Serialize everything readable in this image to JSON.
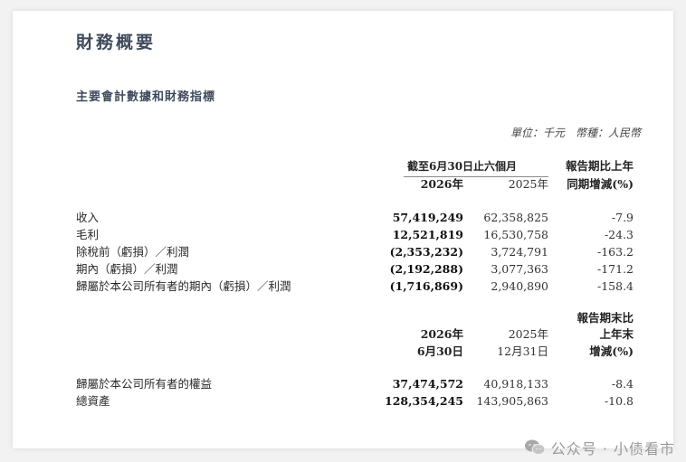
{
  "title": "財務概要",
  "subtitle": "主要會計數據和財務指標",
  "unit_note": "單位：千元　幣種：人民幣",
  "table1": {
    "period_header": "截至6月30日止六個月",
    "col1": "2026年",
    "col2": "2025年",
    "col3_line1": "報告期比上年",
    "col3_line2": "同期增減(%)",
    "rows": [
      {
        "label": "收入",
        "v2026": "57,419,249",
        "v2025": "62,358,825",
        "chg": "-7.9"
      },
      {
        "label": "毛利",
        "v2026": "12,521,819",
        "v2025": "16,530,758",
        "chg": "-24.3"
      },
      {
        "label": "除稅前（虧損）／利潤",
        "v2026": "(2,353,232)",
        "v2025": "3,724,791",
        "chg": "-163.2"
      },
      {
        "label": "期內（虧損）／利潤",
        "v2026": "(2,192,288)",
        "v2025": "3,077,363",
        "chg": "-171.2"
      },
      {
        "label": "歸屬於本公司所有者的期內（虧損）／利潤",
        "v2026": "(1,716,869)",
        "v2025": "2,940,890",
        "chg": "-158.4"
      }
    ]
  },
  "table2": {
    "col1_line1": "2026年",
    "col1_line2": "6月30日",
    "col2_line1": "2025年",
    "col2_line2": "12月31日",
    "col3_line1": "報告期末比",
    "col3_line2": "上年末",
    "col3_line3": "增減(%)",
    "rows": [
      {
        "label": "歸屬於本公司所有者的權益",
        "v1": "37,474,572",
        "v2": "40,918,133",
        "chg": "-8.4"
      },
      {
        "label": "總資產",
        "v1": "128,354,245",
        "v2": "143,905,863",
        "chg": "-10.8"
      }
    ]
  },
  "watermark": {
    "icon": "wechat-icon",
    "text": "公众号 · 小债看市"
  }
}
